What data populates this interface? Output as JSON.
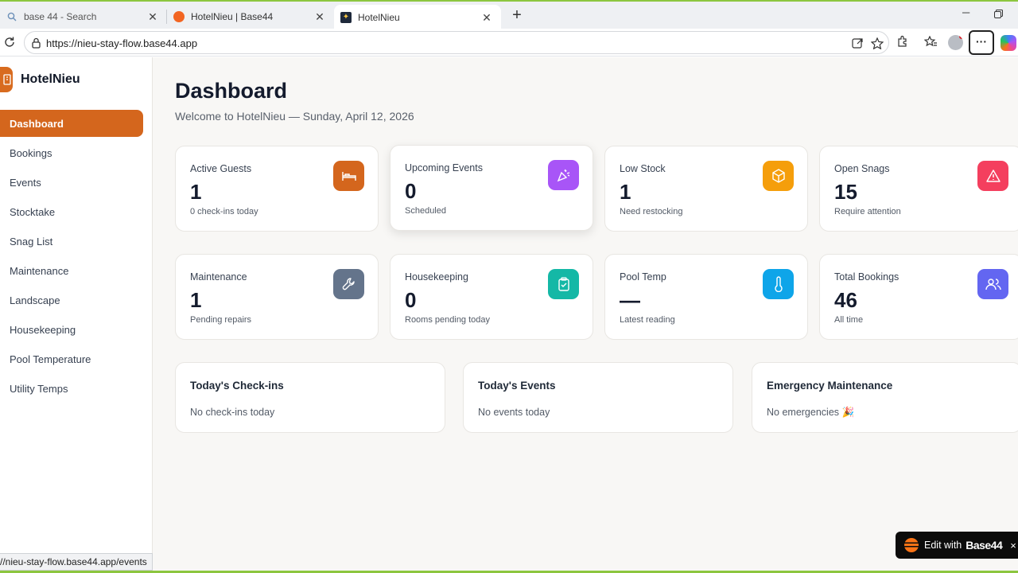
{
  "browser": {
    "tabs": [
      {
        "title": "base 44 - Search",
        "active": false
      },
      {
        "title": "HotelNieu | Base44",
        "active": false
      },
      {
        "title": "HotelNieu",
        "active": true
      }
    ],
    "new_tab_label": "+",
    "url": "https://nieu-stay-flow.base44.app",
    "status_url": "//nieu-stay-flow.base44.app/events",
    "more_label": "···"
  },
  "app": {
    "brand": "HotelNieu",
    "nav": [
      {
        "label": "Dashboard",
        "active": true
      },
      {
        "label": "Bookings"
      },
      {
        "label": "Events"
      },
      {
        "label": "Stocktake"
      },
      {
        "label": "Snag List"
      },
      {
        "label": "Maintenance"
      },
      {
        "label": "Landscape"
      },
      {
        "label": "Housekeeping"
      },
      {
        "label": "Pool Temperature"
      },
      {
        "label": "Utility Temps"
      }
    ]
  },
  "dashboard": {
    "title": "Dashboard",
    "subtitle": "Welcome to HotelNieu — Sunday, April 12, 2026",
    "stats": [
      {
        "label": "Active Guests",
        "value": "1",
        "sub": "0 check-ins today",
        "icon": "bed-icon",
        "color": "#d4661d"
      },
      {
        "label": "Upcoming Events",
        "value": "0",
        "sub": "Scheduled",
        "icon": "party-popper-icon",
        "color": "#a855f7"
      },
      {
        "label": "Low Stock",
        "value": "1",
        "sub": "Need restocking",
        "icon": "package-icon",
        "color": "#f59e0b"
      },
      {
        "label": "Open Snags",
        "value": "15",
        "sub": "Require attention",
        "icon": "alert-triangle-icon",
        "color": "#f43f5e"
      },
      {
        "label": "Maintenance",
        "value": "1",
        "sub": "Pending repairs",
        "icon": "wrench-icon",
        "color": "#64748b"
      },
      {
        "label": "Housekeeping",
        "value": "0",
        "sub": "Rooms pending today",
        "icon": "clipboard-check-icon",
        "color": "#14b8a6"
      },
      {
        "label": "Pool Temp",
        "value": "—",
        "sub": "Latest reading",
        "icon": "thermometer-icon",
        "color": "#0ea5e9"
      },
      {
        "label": "Total Bookings",
        "value": "46",
        "sub": "All time",
        "icon": "users-icon",
        "color": "#6366f1"
      }
    ],
    "panels": [
      {
        "title": "Today's Check-ins",
        "empty": "No check-ins today"
      },
      {
        "title": "Today's Events",
        "empty": "No events today"
      },
      {
        "title": "Emergency Maintenance",
        "empty": "No emergencies 🎉"
      }
    ]
  },
  "edit_badge": {
    "text": "Edit with",
    "brand": "Base44",
    "close": "×"
  }
}
